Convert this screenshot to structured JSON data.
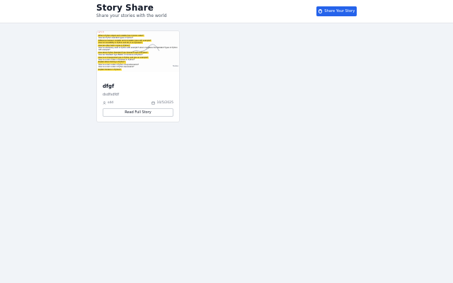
{
  "header": {
    "title": "Story Share",
    "subtitle": "Share your stories with the world",
    "share_button_label": "Share Your Story",
    "share_icon": "plus-circle-icon"
  },
  "stories": [
    {
      "title": "dfgf",
      "excerpt": "dsdfsdfdf",
      "author": "sdd",
      "date": "10/5/2025",
      "read_button_label": "Read Full Story",
      "author_icon": "user-icon",
      "date_icon": "calendar-icon",
      "thumbnail_lines": [
        "What is Python object and mutable how it stores value?",
        "How are Python standard types in Python?",
        "Difference between mutable and immutable types with example?",
        "How is Immutability in Python and why it is important?",
        "How are other built in types in Python?",
        "How is a dictionary used in Python with example? How it compares the Standard Types in Python",
        "with example?",
        "How about Python Standard Type Operators with examples?",
        "How are Standard Type Builtin in Functions in Python?",
        "How is an Unsupported type in Python and give an example?",
        "How is a return code in Cointrace in Python?",
        "Explain about Sorting in Python?",
        "How is a return code in Python Comprehensions?",
        "How is a return code in Python Generators?",
        "Explain Iterators in Python?"
      ]
    }
  ],
  "colors": {
    "accent": "#2563eb",
    "page_background": "#f1f4f8",
    "highlight": "#fde047"
  }
}
